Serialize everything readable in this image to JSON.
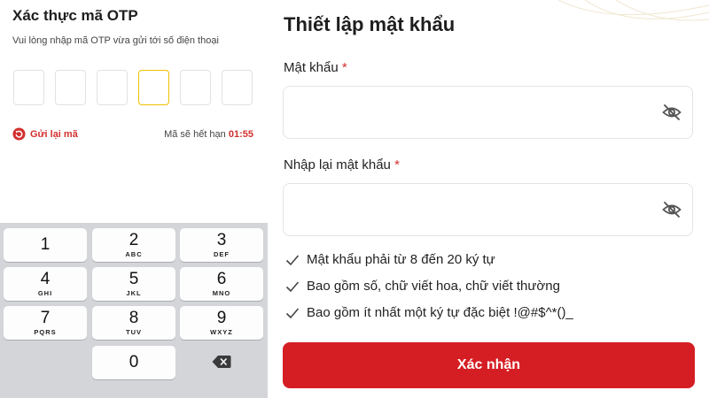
{
  "otp": {
    "title": "Xác thực mã OTP",
    "subtitle": "Vui lòng nhập mã OTP vừa gửi tới số điện thoại",
    "box_count": 6,
    "active_box_index": 3,
    "resend_label": "Gửi lại mã",
    "expire_label": "Mã sẽ hết hạn ",
    "expire_time": "01:55"
  },
  "keypad": {
    "keys": [
      {
        "num": "1",
        "letters": ""
      },
      {
        "num": "2",
        "letters": "ABC"
      },
      {
        "num": "3",
        "letters": "DEF"
      },
      {
        "num": "4",
        "letters": "GHI"
      },
      {
        "num": "5",
        "letters": "JKL"
      },
      {
        "num": "6",
        "letters": "MNO"
      },
      {
        "num": "7",
        "letters": "PQRS"
      },
      {
        "num": "8",
        "letters": "TUV"
      },
      {
        "num": "9",
        "letters": "WXYZ"
      },
      {
        "num": "0",
        "letters": ""
      }
    ],
    "backspace_icon": "backspace-icon"
  },
  "password_form": {
    "title": "Thiết lập mật khẩu",
    "password_label": "Mật khẩu",
    "password_value": "",
    "confirm_label": "Nhập lại mật khẩu",
    "confirm_value": "",
    "required_mark": "*",
    "eye_icon": "eye-off-icon",
    "rules": [
      "Mật khẩu phải từ 8 đến 20 ký tự",
      "Bao gồm số, chữ viết hoa, chữ viết thường",
      "Bao gồm ít nhất một ký tự đặc biệt !@#$^*()_"
    ],
    "submit_label": "Xác nhận"
  },
  "colors": {
    "accent_red": "#d51e24",
    "otp_active_border": "#f0c000",
    "keypad_bg": "#d3d5d9"
  }
}
